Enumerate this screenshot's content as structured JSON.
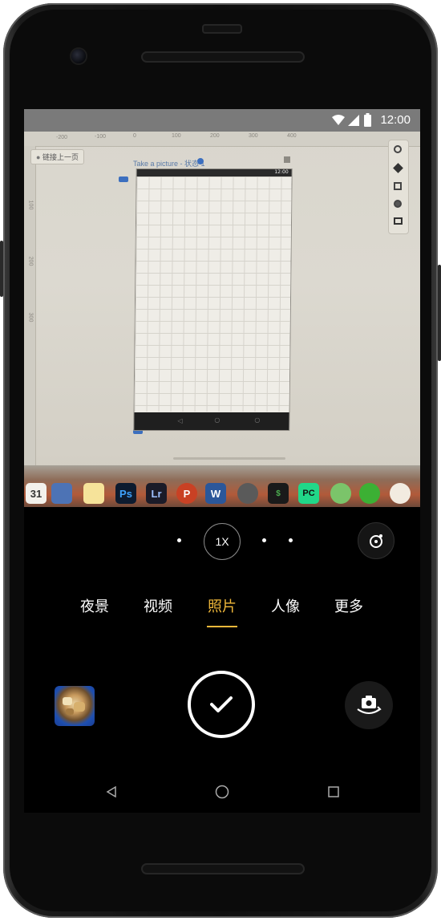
{
  "status_bar": {
    "time": "12:00",
    "icons": [
      "wifi-icon",
      "signal-icon",
      "battery-icon"
    ]
  },
  "viewfinder": {
    "back_chip": "链接上一页",
    "prototype_title": "Take a picture - 状态 1",
    "prototype_time": "12:00",
    "ruler_top": [
      "-200",
      "-100",
      "0",
      "100",
      "200",
      "300",
      "400"
    ],
    "ruler_left": [
      "100",
      "200",
      "300"
    ],
    "dock_apps": [
      "31",
      "",
      "",
      "Ps",
      "Lr",
      "P",
      "W",
      "",
      "$",
      "PC",
      "",
      "",
      ""
    ]
  },
  "camera": {
    "zoom_label": "1X",
    "modes": [
      "夜景",
      "视频",
      "照片",
      "人像",
      "更多"
    ],
    "active_mode": "照片"
  },
  "colors": {
    "accent": "#f0b83a",
    "status_bar": "#7a7a7a",
    "background": "#000000"
  },
  "nav": {
    "icons": [
      "back-icon",
      "home-icon",
      "recents-icon"
    ]
  }
}
